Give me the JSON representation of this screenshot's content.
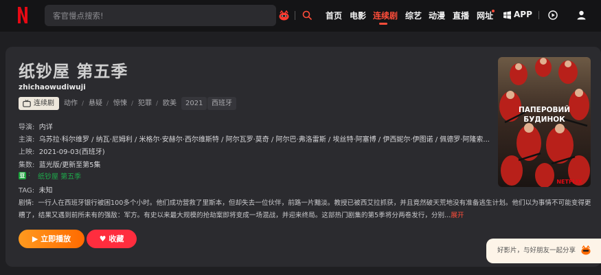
{
  "header": {
    "logo": "N",
    "search_placeholder": "客官慢点搜索!",
    "nav": [
      {
        "label": "首页"
      },
      {
        "label": "电影"
      },
      {
        "label": "连续剧"
      },
      {
        "label": "综艺"
      },
      {
        "label": "动漫"
      },
      {
        "label": "直播"
      },
      {
        "label": "网址"
      },
      {
        "label": "APP"
      }
    ],
    "active_nav": "连续剧"
  },
  "detail": {
    "title": "纸钞屋 第五季",
    "pinyin": "zhichaowudiwuji",
    "category_tag": "连续剧",
    "genres": [
      "动作",
      "悬疑",
      "惊悚",
      "犯罪"
    ],
    "region": "欧美",
    "year": "2021",
    "language": "西班牙",
    "fields": {
      "director_label": "导演:",
      "director_value": "内详",
      "cast_label": "主演:",
      "cast_value": "乌苏拉·科尔维罗 / 纳瓦·尼姆利 / 米格尔·安赫尔·西尔维斯特 / 阿尔瓦罗·莫奇 / 阿尔巴·弗洛雷斯 / 埃丝特·阿塞博 / 伊西妮尔·伊图诺 / 佩德罗·阿隆索...",
      "release_label": "上映:",
      "release_value": "2021-09-03(西班牙)",
      "episodes_label": "集数:",
      "episodes_value": "蓝光版/更新至第5集",
      "douban_badge": "豆",
      "douban_link": "纸钞屋 第五季",
      "tag_label": "TAG:",
      "tag_value": "未知",
      "plot_label": "剧情:",
      "plot_value": "一行人在西班牙银行被困100多个小时。他们成功营救了里斯本，但却失去一位伙伴，前路一片黯淡。教授已被西艾拉抓获，并且竟然破天荒地没有准备逃生计划。他们以为事情不可能变得更糟了，结果又遇到前所未有的强敌：军方。有史以来最大规模的抢劫案即将变成一场混战，并迎来终局。这部热门剧集的第5季将分两卷发行，分别...",
      "plot_more": "展开"
    },
    "buttons": {
      "play": "立即播放",
      "favorite": "收藏"
    },
    "poster": {
      "title_line1": "ПАПЕРОВИЙ",
      "title_line2": "БУДИНОК",
      "brand": "NETFLIX"
    }
  },
  "share": {
    "text": "好影片，与好朋友一起分享"
  },
  "colors": {
    "accent": "#ff4d3a",
    "play_gradient_start": "#ff9a1f",
    "play_gradient_end": "#ff6a00",
    "favorite": "#ff2d3e",
    "netflix_red": "#e50914"
  }
}
